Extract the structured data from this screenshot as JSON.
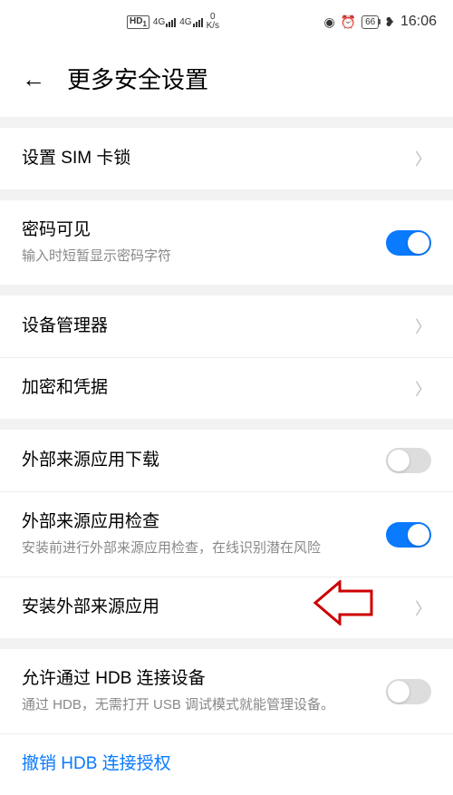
{
  "status": {
    "hd": "HD",
    "sim1": "1",
    "net": "4G",
    "speed_val": "0",
    "speed_unit": "K/s",
    "battery": "66",
    "time": "16:06"
  },
  "header": {
    "title": "更多安全设置"
  },
  "sections": {
    "sim_lock": "设置 SIM 卡锁",
    "pwd_visible_title": "密码可见",
    "pwd_visible_sub": "输入时短暂显示密码字符",
    "device_admin": "设备管理器",
    "encrypt_creds": "加密和凭据",
    "ext_download": "外部来源应用下载",
    "ext_check_title": "外部来源应用检查",
    "ext_check_sub": "安装前进行外部来源应用检查，在线识别潜在风险",
    "install_ext": "安装外部来源应用",
    "hdb_title": "允许通过 HDB 连接设备",
    "hdb_sub": "通过 HDB，无需打开 USB 调试模式就能管理设备。",
    "revoke_hdb": "撤销 HDB 连接授权"
  }
}
